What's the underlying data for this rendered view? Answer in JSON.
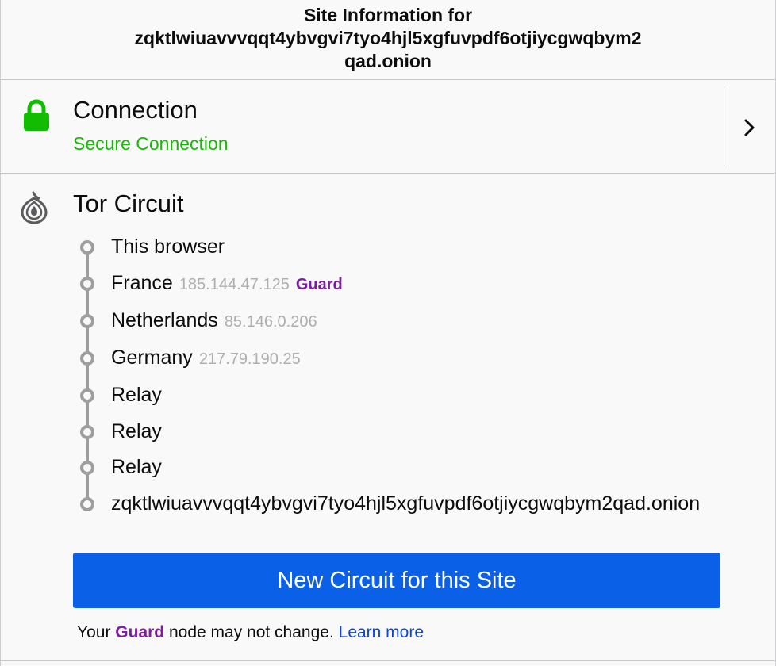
{
  "header": {
    "line1": "Site Information for",
    "line2": "zqktlwiuavvvqqt4ybvgvi7tyo4hjl5xgfuvpdf6otjiycgwqbym2",
    "line3": "qad.onion"
  },
  "connection": {
    "icon": "lock-icon",
    "title": "Connection",
    "status": "Secure Connection",
    "status_color": "#12bc00"
  },
  "tor_circuit": {
    "icon": "onion-icon",
    "title": "Tor Circuit",
    "hops": [
      {
        "name": "This browser",
        "ip": "",
        "role": ""
      },
      {
        "name": "France",
        "ip": "185.144.47.125",
        "role": "Guard"
      },
      {
        "name": "Netherlands",
        "ip": "85.146.0.206",
        "role": ""
      },
      {
        "name": "Germany",
        "ip": "217.79.190.25",
        "role": ""
      },
      {
        "name": "Relay",
        "ip": "",
        "role": ""
      },
      {
        "name": "Relay",
        "ip": "",
        "role": ""
      },
      {
        "name": "Relay",
        "ip": "",
        "role": ""
      },
      {
        "name": "zqktlwiuavvvqqt4ybvgvi7tyo4hjl5xgfuvpdf6otjiycgwqbym2qad.onion",
        "ip": "",
        "role": ""
      }
    ],
    "new_circuit_label": "New Circuit for this Site",
    "note_prefix": "Your",
    "note_guard_word": "Guard",
    "note_suffix": "node may not change.",
    "learn_more_label": "Learn more"
  },
  "colors": {
    "accent_button": "#0a60e6",
    "guard_purple": "#7d1ea1",
    "link_blue": "#0a45d8",
    "ip_gray": "#aeaeb0"
  }
}
